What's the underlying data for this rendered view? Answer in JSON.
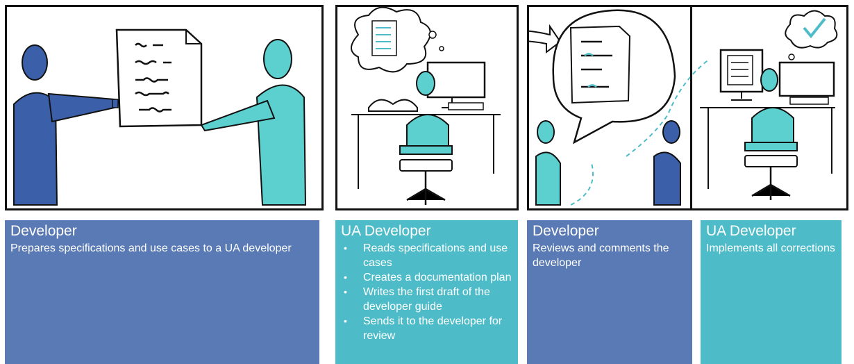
{
  "colors": {
    "dev_blue": "#5a7ab5",
    "ua_teal": "#4dbcc8",
    "figure_blue": "#3b5fa8",
    "figure_teal": "#5ccfcf"
  },
  "icons": [
    "document-icon",
    "thought-bubble-icon",
    "speech-bubble-icon",
    "checkmark-icon",
    "computer-icon",
    "book-icon",
    "chair-icon"
  ],
  "cards": [
    {
      "role": "Developer",
      "desc": "Prepares specifications and use cases to a UA developer"
    },
    {
      "role": "UA Developer",
      "bullets": [
        "Reads specifications and use cases",
        "Creates a documentation plan",
        "Writes the first draft of the developer guide",
        "Sends it to the developer for review"
      ]
    },
    {
      "role": "Developer",
      "desc": "Reviews and comments the developer"
    },
    {
      "role": "UA Developer",
      "desc": "Implements all corrections"
    }
  ]
}
